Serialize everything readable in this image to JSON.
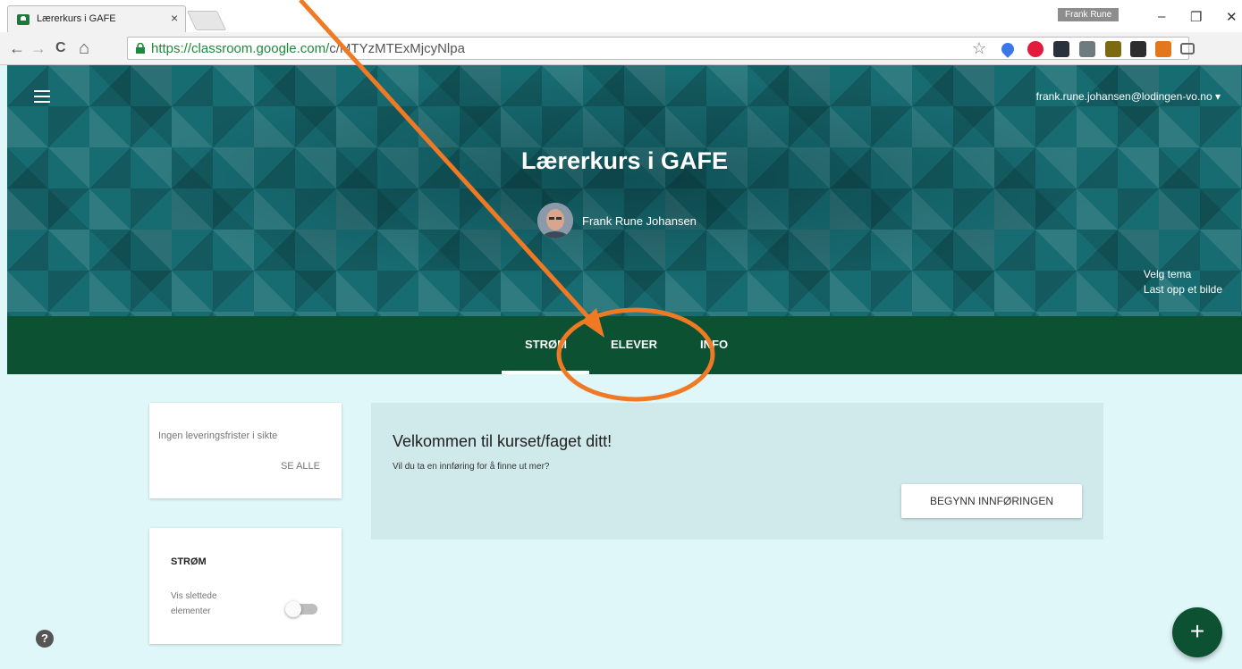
{
  "browser": {
    "tab_title": "Lærerkurs i GAFE",
    "tab_close": "×",
    "profile_name": "Frank Rune",
    "url_host": "https://classroom.google.com/",
    "url_path": "c/MTYzMTExMjcyNlpa",
    "window_controls": {
      "minimize": "–",
      "restore": "❐",
      "close": "✕"
    },
    "nav": {
      "back": "←",
      "forward": "→",
      "reload": "C",
      "home": "⌂"
    },
    "star": "☆"
  },
  "header": {
    "account_email": "frank.rune.johansen@lodingen-vo.no",
    "account_caret": "▾",
    "class_title": "Lærerkurs i GAFE",
    "teacher_name": "Frank Rune Johansen",
    "theme_links": {
      "choose_theme": "Velg tema",
      "upload_image": "Last opp et bilde"
    }
  },
  "tabs": [
    {
      "label": "STRØM",
      "active": true
    },
    {
      "label": "ELEVER",
      "active": false
    },
    {
      "label": "INFO",
      "active": false
    }
  ],
  "deadlines_card": {
    "text": "Ingen leveringsfrister i sikte",
    "see_all": "SE ALLE"
  },
  "stream_card": {
    "title": "STRØM",
    "toggle_label": "Vis slettede elementer",
    "toggle_on": false
  },
  "welcome": {
    "heading": "Velkommen til kurset/faget ditt!",
    "subtext": "Vil du ta en innføring for å finne ut mer?",
    "button": "BEGYNN INNFØRINGEN"
  },
  "help": "?",
  "fab": "+",
  "colors": {
    "banner": "#176c72",
    "tab_bar": "#0b5132",
    "page_background": "#e0f7fa",
    "annotation": "#f07a24"
  }
}
